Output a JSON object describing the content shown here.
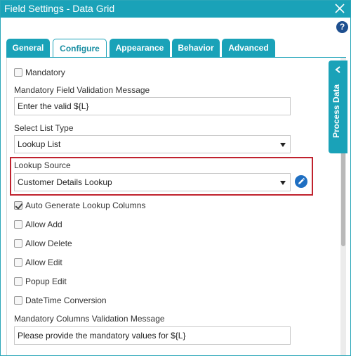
{
  "window": {
    "title": "Field Settings - Data Grid",
    "close_icon": "close-icon",
    "help_icon": "help-icon",
    "help_glyph": "?"
  },
  "tabs": [
    {
      "label": "General",
      "active": false
    },
    {
      "label": "Configure",
      "active": true
    },
    {
      "label": "Appearance",
      "active": false
    },
    {
      "label": "Behavior",
      "active": false
    },
    {
      "label": "Advanced",
      "active": false
    }
  ],
  "side_panel": {
    "label": "Process Data",
    "icon": "chevron-left-icon"
  },
  "form": {
    "mandatory": {
      "label": "Mandatory",
      "checked": false
    },
    "mandatory_message": {
      "label": "Mandatory Field Validation Message",
      "value": "Enter the valid ${L}"
    },
    "select_list_type": {
      "label": "Select List Type",
      "value": "Lookup List"
    },
    "lookup_source": {
      "label": "Lookup Source",
      "value": "Customer Details Lookup",
      "edit_icon": "pencil-icon"
    },
    "auto_generate": {
      "label": "Auto Generate Lookup Columns",
      "checked": true
    },
    "allow_add": {
      "label": "Allow Add",
      "checked": false
    },
    "allow_delete": {
      "label": "Allow Delete",
      "checked": false
    },
    "allow_edit": {
      "label": "Allow Edit",
      "checked": false
    },
    "popup_edit": {
      "label": "Popup Edit",
      "checked": false
    },
    "datetime_conversion": {
      "label": "DateTime Conversion",
      "checked": false
    },
    "mandatory_columns_message": {
      "label": "Mandatory Columns Validation Message",
      "value": "Please provide the mandatory values for ${L}"
    }
  },
  "colors": {
    "accent": "#1aa2b8",
    "highlight": "#c0222e",
    "edit_button": "#1f6fc2",
    "help_button": "#1e4f8f"
  }
}
